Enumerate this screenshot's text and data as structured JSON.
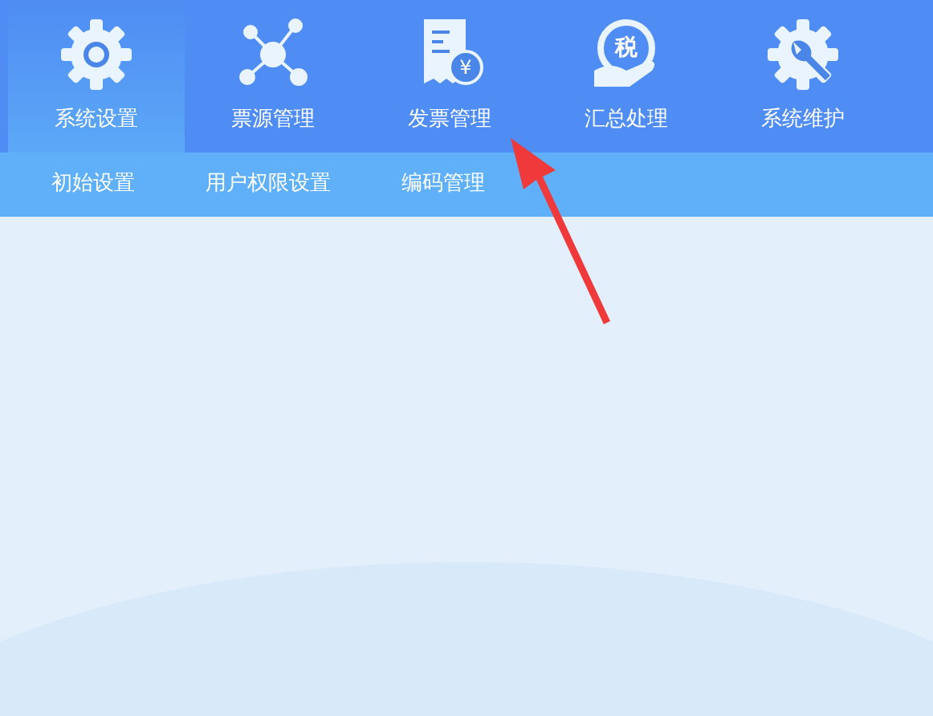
{
  "toolbar": {
    "tabs": [
      {
        "label": "系统设置",
        "kind": "gear",
        "selected": true
      },
      {
        "label": "票源管理",
        "kind": "network",
        "selected": false
      },
      {
        "label": "发票管理",
        "kind": "invoice",
        "badge_text": "¥",
        "selected": false
      },
      {
        "label": "汇总处理",
        "kind": "tax",
        "badge_text": "税",
        "selected": false
      },
      {
        "label": "系统维护",
        "kind": "wrench",
        "selected": false
      }
    ]
  },
  "subtabs": [
    {
      "label": "初始设置"
    },
    {
      "label": "用户权限设置"
    },
    {
      "label": "编码管理"
    }
  ]
}
